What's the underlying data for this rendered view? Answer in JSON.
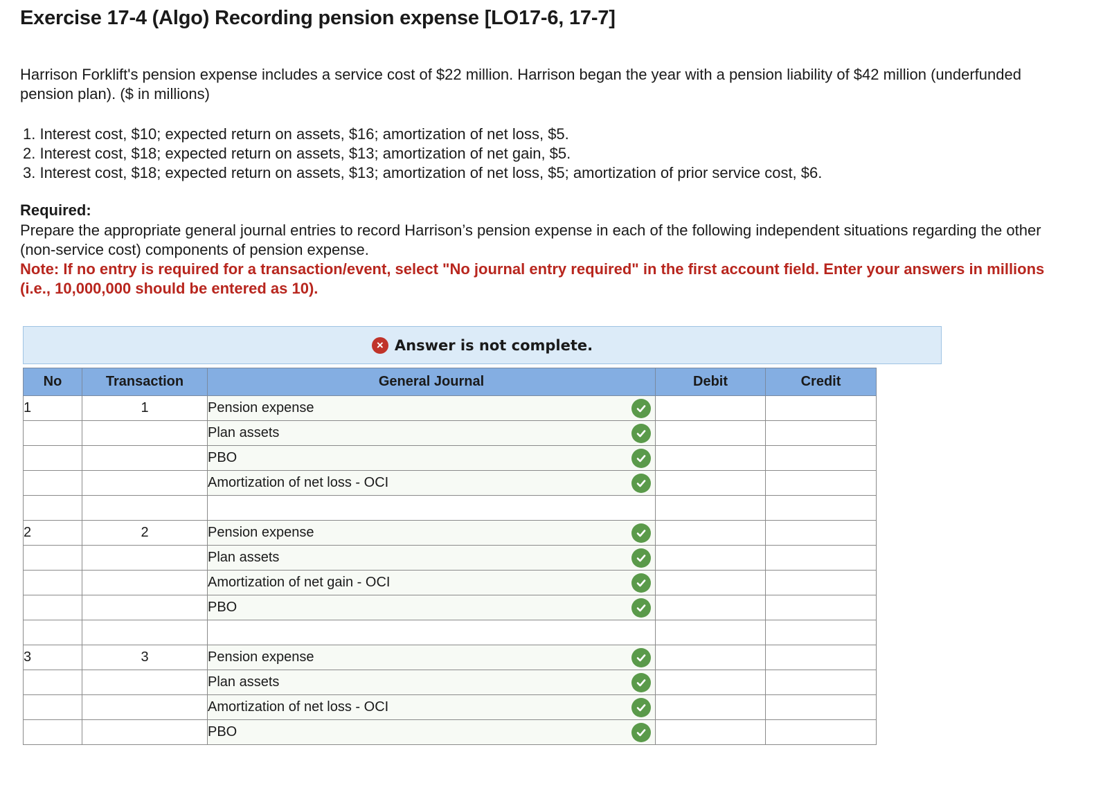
{
  "title": "Exercise 17-4 (Algo) Recording pension expense [LO17-6, 17-7]",
  "intro": "Harrison Forklift's pension expense includes a service cost of $22 million. Harrison began the year with a pension liability of $42 million (underfunded pension plan). ($ in millions)",
  "situations": [
    "1. Interest cost, $10; expected return on assets, $16; amortization of net loss, $5.",
    "2. Interest cost, $18; expected return on assets, $13; amortization of net gain, $5.",
    "3. Interest cost, $18; expected return on assets, $13; amortization of net loss, $5; amortization of prior service cost, $6."
  ],
  "required": {
    "heading": "Required:",
    "text": "Prepare the appropriate general journal entries to record Harrison’s pension expense in each of the following independent situations regarding the other (non-service cost) components of pension expense.",
    "note": "Note: If no entry is required for a transaction/event, select \"No journal entry required\" in the first account field. Enter your answers in millions (i.e., 10,000,000 should be entered as 10)."
  },
  "banner": {
    "icon": "close-circle-icon",
    "symbol": "×",
    "text": "Answer is not complete."
  },
  "table": {
    "headers": {
      "no": "No",
      "transaction": "Transaction",
      "journal": "General Journal",
      "debit": "Debit",
      "credit": "Credit"
    },
    "rows": [
      {
        "no": "1",
        "transaction": "1",
        "account": "Pension expense",
        "checked": true,
        "debit": "",
        "credit": ""
      },
      {
        "no": "",
        "transaction": "",
        "account": "Plan assets",
        "checked": true,
        "debit": "",
        "credit": ""
      },
      {
        "no": "",
        "transaction": "",
        "account": "PBO",
        "checked": true,
        "debit": "",
        "credit": ""
      },
      {
        "no": "",
        "transaction": "",
        "account": "Amortization of net loss - OCI",
        "checked": true,
        "debit": "",
        "credit": ""
      },
      {
        "no": "",
        "transaction": "",
        "account": "",
        "checked": false,
        "debit": "",
        "credit": ""
      },
      {
        "no": "2",
        "transaction": "2",
        "account": "Pension expense",
        "checked": true,
        "debit": "",
        "credit": ""
      },
      {
        "no": "",
        "transaction": "",
        "account": "Plan assets",
        "checked": true,
        "debit": "",
        "credit": ""
      },
      {
        "no": "",
        "transaction": "",
        "account": "Amortization of net gain - OCI",
        "checked": true,
        "debit": "",
        "credit": ""
      },
      {
        "no": "",
        "transaction": "",
        "account": "PBO",
        "checked": true,
        "debit": "",
        "credit": ""
      },
      {
        "no": "",
        "transaction": "",
        "account": "",
        "checked": false,
        "debit": "",
        "credit": ""
      },
      {
        "no": "3",
        "transaction": "3",
        "account": "Pension expense",
        "checked": true,
        "debit": "",
        "credit": ""
      },
      {
        "no": "",
        "transaction": "",
        "account": "Plan assets",
        "checked": true,
        "debit": "",
        "credit": ""
      },
      {
        "no": "",
        "transaction": "",
        "account": "Amortization of net loss - OCI",
        "checked": true,
        "debit": "",
        "credit": ""
      },
      {
        "no": "",
        "transaction": "",
        "account": "PBO",
        "checked": true,
        "debit": "",
        "credit": ""
      }
    ]
  },
  "colors": {
    "accent_header": "#84aee2",
    "banner_bg": "#dcebf8",
    "note_red": "#b8261e",
    "check_green": "#5a9a4a",
    "error_red": "#c0332a"
  },
  "icons": {
    "row_status": "check-circle-icon"
  }
}
